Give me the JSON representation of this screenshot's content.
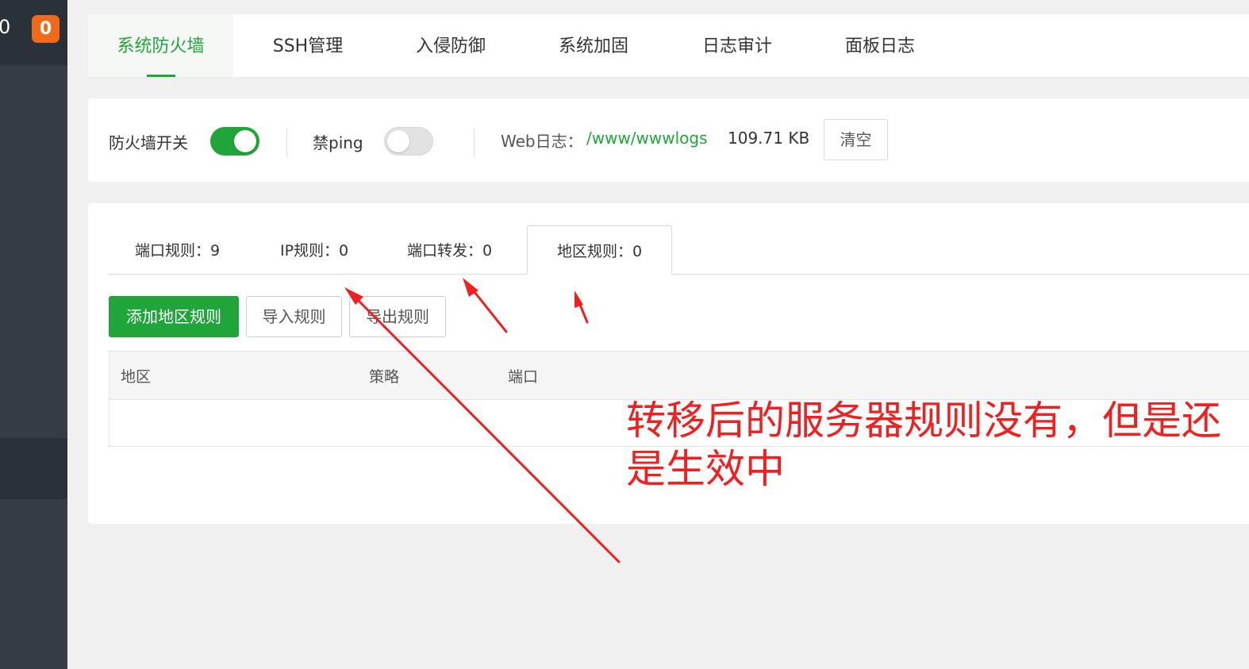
{
  "sidebar": {
    "count_text": "0",
    "badge_text": "0"
  },
  "top_tabs": [
    {
      "label": "系统防火墙",
      "active": true
    },
    {
      "label": "SSH管理",
      "active": false
    },
    {
      "label": "入侵防御",
      "active": false
    },
    {
      "label": "系统加固",
      "active": false
    },
    {
      "label": "日志审计",
      "active": false
    },
    {
      "label": "面板日志",
      "active": false
    }
  ],
  "settings": {
    "firewall_label": "防火墙开关",
    "firewall_on": true,
    "ping_label": "禁ping",
    "ping_on": false,
    "web_log_label": "Web日志：",
    "web_log_path": "/www/wwwlogs",
    "web_log_size": "109.71 KB",
    "clear_button": "清空"
  },
  "rule_tabs": [
    {
      "label": "端口规则：9",
      "active": false
    },
    {
      "label": "IP规则：0",
      "active": false
    },
    {
      "label": "端口转发：0",
      "active": false
    },
    {
      "label": "地区规则：0",
      "active": true
    }
  ],
  "actions": {
    "add_label": "添加地区规则",
    "import_label": "导入规则",
    "export_label": "导出规则"
  },
  "table": {
    "columns": [
      "地区",
      "策略",
      "端口"
    ]
  },
  "annotation": {
    "text": "转移后的服务器规则没有，但是还是生效中",
    "color": "#f02020"
  },
  "colors": {
    "accent": "#20a53a",
    "badge": "#f06a1e",
    "sidebar": "#353c45"
  }
}
